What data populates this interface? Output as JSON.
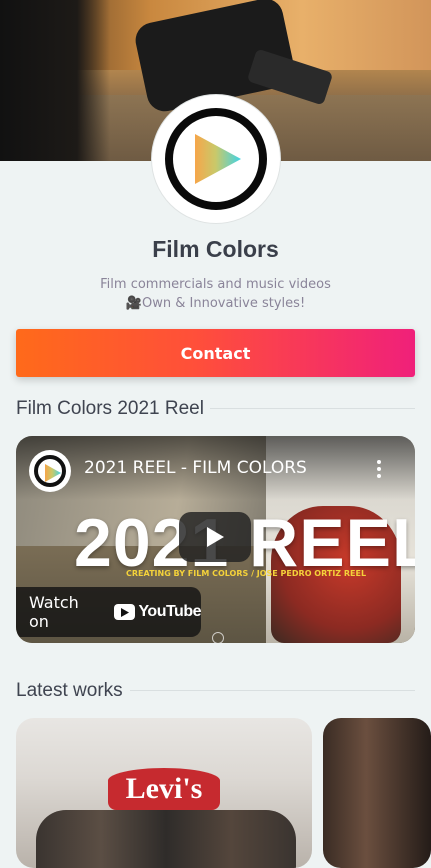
{
  "profile": {
    "name": "Film Colors",
    "bio_line1": "Film commercials and music videos",
    "bio_line2": "🎥Own & Innovative styles!"
  },
  "contact_button": {
    "label": "Contact"
  },
  "reel_section": {
    "title": "Film Colors 2021 Reel",
    "video": {
      "title": "2021 REEL - FILM COLORS",
      "overlay_text": "2021 REEL",
      "credit": "CREATING BY FILM COLORS / JOSE PEDRO ORTIZ REEL",
      "watch_on": "Watch on",
      "youtube_label": "YouTube"
    }
  },
  "latest_section": {
    "title": "Latest works",
    "card1_brand": "Levi's"
  },
  "colors": {
    "contact_gradient_start": "#ff6a1a",
    "contact_gradient_end": "#f0207a",
    "background": "#eef3f3"
  },
  "icons": [
    "play-logo-icon",
    "play-icon",
    "youtube-icon",
    "more-vert-icon"
  ]
}
